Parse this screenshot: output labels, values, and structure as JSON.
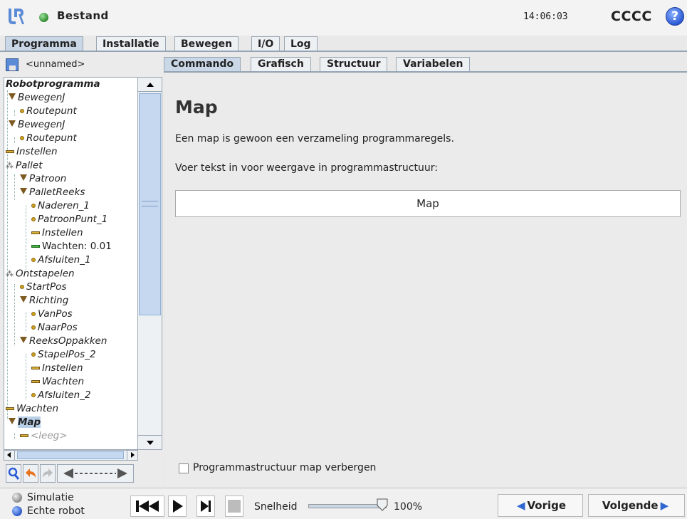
{
  "header": {
    "title": "Bestand",
    "time": "14:06:03",
    "robot_name": "CCCC",
    "help_symbol": "?",
    "status_color": "#2f8a2f"
  },
  "main_tabs": [
    {
      "label": "Programma",
      "active": true
    },
    {
      "label": "Installatie",
      "active": false
    },
    {
      "label": "Bewegen",
      "active": false
    },
    {
      "label": "I/O",
      "active": false
    },
    {
      "label": "Log",
      "active": false
    }
  ],
  "program": {
    "file_name": "<unnamed>",
    "tree": [
      {
        "label": "Robotprogramma",
        "icon": "none"
      },
      {
        "label": "BewegenJ",
        "icon": "move-icon"
      },
      {
        "label": "Routepunt",
        "icon": "waypoint-icon"
      },
      {
        "label": "BewegenJ",
        "icon": "move-icon"
      },
      {
        "label": "Routepunt",
        "icon": "waypoint-icon"
      },
      {
        "label": "Instellen",
        "icon": "set-icon"
      },
      {
        "label": "Pallet",
        "icon": "pallet-icon"
      },
      {
        "label": "Patroon",
        "icon": "move-icon"
      },
      {
        "label": "PalletReeks",
        "icon": "move-icon"
      },
      {
        "label": "Naderen_1",
        "icon": "waypoint-icon"
      },
      {
        "label": "PatroonPunt_1",
        "icon": "waypoint-icon"
      },
      {
        "label": "Instellen",
        "icon": "set-icon"
      },
      {
        "label": "Wachten: 0.01",
        "icon": "wait-icon"
      },
      {
        "label": "Afsluiten_1",
        "icon": "waypoint-icon"
      },
      {
        "label": "Ontstapelen",
        "icon": "pallet-icon"
      },
      {
        "label": "StartPos",
        "icon": "waypoint-icon"
      },
      {
        "label": "Richting",
        "icon": "move-icon"
      },
      {
        "label": "VanPos",
        "icon": "waypoint-icon"
      },
      {
        "label": "NaarPos",
        "icon": "waypoint-icon"
      },
      {
        "label": "ReeksOppakken",
        "icon": "move-icon"
      },
      {
        "label": "StapelPos_2",
        "icon": "waypoint-icon"
      },
      {
        "label": "Instellen",
        "icon": "set-icon"
      },
      {
        "label": "Wachten",
        "icon": "set-icon"
      },
      {
        "label": "Afsluiten_2",
        "icon": "waypoint-icon"
      },
      {
        "label": "Wachten",
        "icon": "set-icon"
      },
      {
        "label": "Map",
        "icon": "move-icon",
        "selected": true
      },
      {
        "label": "<leeg>",
        "icon": "set-icon"
      }
    ]
  },
  "sub_tabs": [
    {
      "label": "Commando",
      "active": true
    },
    {
      "label": "Grafisch",
      "active": false
    },
    {
      "label": "Structuur",
      "active": false
    },
    {
      "label": "Variabelen",
      "active": false
    }
  ],
  "folder_page": {
    "heading": "Map",
    "description": "Een map is gewoon een verzameling programmaregels.",
    "input_label": "Voer tekst in voor weergave in programmastructuur:",
    "input_value": "Map",
    "hide_checkbox_label": "Programmastructuur map verbergen",
    "hide_checked": false
  },
  "footer": {
    "mode_simulation": "Simulatie",
    "mode_real": "Echte robot",
    "speed_label": "Snelheid",
    "speed_value": "100%",
    "speed_fraction": 1.0,
    "prev_label": "Vorige",
    "next_label": "Volgende"
  }
}
